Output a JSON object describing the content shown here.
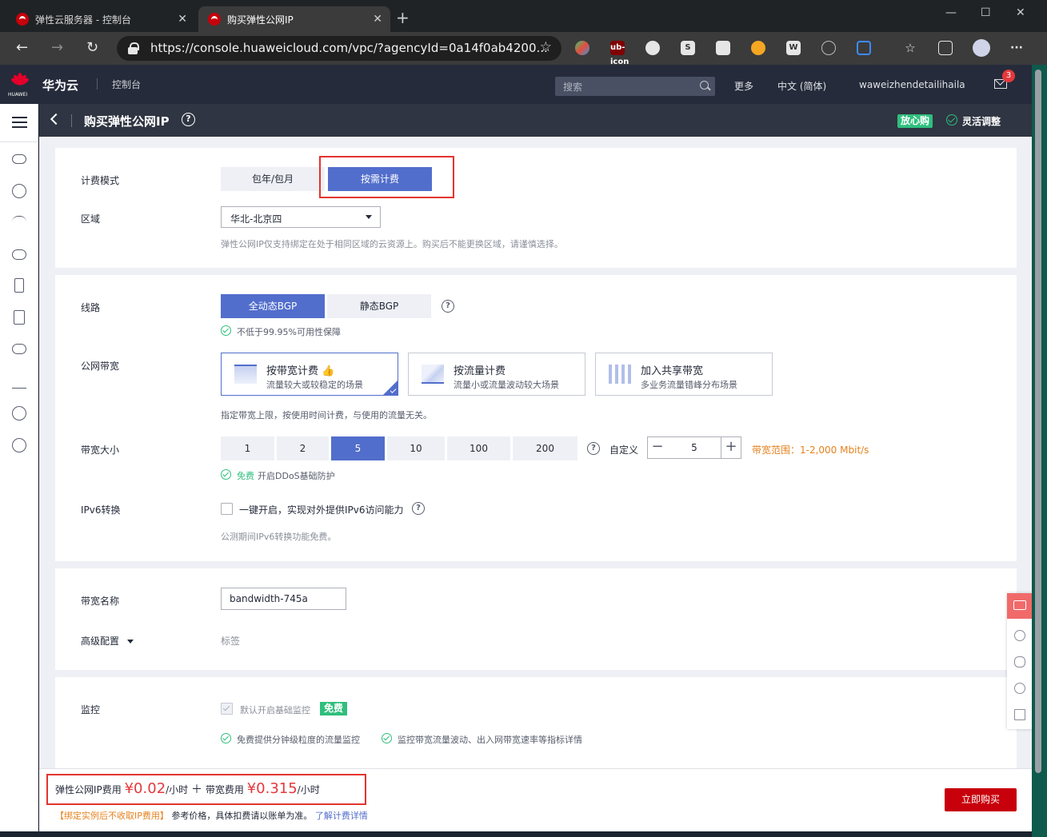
{
  "browser": {
    "tabs": [
      {
        "title": "弹性云服务器 - 控制台",
        "active": false
      },
      {
        "title": "购买弹性公网IP",
        "active": true
      }
    ],
    "url": "https://console.huaweicloud.com/vpc/?agencyId=0a14f0ab4200...",
    "extensions": [
      "ub-icon",
      "s-icon",
      "w-icon"
    ]
  },
  "header": {
    "logo_text": "HUAWEI",
    "brand": "华为云",
    "console": "控制台",
    "search_placeholder": "搜索",
    "more": "更多",
    "language": "中文 (简体)",
    "username": "waweizhendetailihaila",
    "mail_badge": "3"
  },
  "titlebar": {
    "title": "购买弹性公网IP",
    "help": "?",
    "fangxin": "放心购",
    "flex": "灵活调整"
  },
  "billing": {
    "label": "计费模式",
    "options": [
      "包年/包月",
      "按需计费"
    ],
    "selected": "按需计费"
  },
  "region": {
    "label": "区域",
    "value": "华北-北京四",
    "hint": "弹性公网IP仅支持绑定在处于相同区域的云资源上。购买后不能更换区域，请谨慎选择。"
  },
  "line": {
    "label": "线路",
    "options": [
      "全动态BGP",
      "静态BGP"
    ],
    "selected": "全动态BGP",
    "sla": "不低于99.95%可用性保障"
  },
  "bandwidth_type": {
    "label": "公网带宽",
    "options": [
      {
        "title": "按带宽计费",
        "desc": "流量较大或较稳定的场景",
        "selected": true
      },
      {
        "title": "按流量计费",
        "desc": "流量小或流量波动较大场景",
        "selected": false
      },
      {
        "title": "加入共享带宽",
        "desc": "多业务流量错峰分布场景",
        "selected": false
      }
    ],
    "hint": "指定带宽上限，按使用时间计费，与使用的流量无关。"
  },
  "bandwidth_size": {
    "label": "带宽大小",
    "options": [
      "1",
      "2",
      "5",
      "10",
      "100",
      "200"
    ],
    "selected": "5",
    "custom_label": "自定义",
    "custom_value": "5",
    "minus": "−",
    "plus": "+",
    "range": "带宽范围：1-2,000 Mbit/s",
    "ddos_free": "免费",
    "ddos_text": "开启DDoS基础防护"
  },
  "ipv6": {
    "label": "IPv6转换",
    "checkbox": "一键开启，实现对外提供IPv6访问能力",
    "hint": "公测期间IPv6转换功能免费。"
  },
  "name": {
    "label": "带宽名称",
    "value": "bandwidth-745a"
  },
  "advanced": {
    "label": "高级配置",
    "value": "标签"
  },
  "monitor": {
    "label": "监控",
    "checkbox": "默认开启基础监控",
    "free_badge": "免费",
    "features": [
      "免费提供分钟级粒度的流量监控",
      "监控带宽流量波动、出入网带宽速率等指标详情"
    ]
  },
  "footer": {
    "ip_fee_label": "弹性公网IP费用",
    "ip_fee": "¥0.02",
    "unit": "/小时",
    "plus": "＋",
    "bw_fee_label": "带宽费用",
    "bw_fee": "¥0.315",
    "note_red": "【绑定实例后不收取IP费用】",
    "note": "参考价格，具体扣费请以账单为准。",
    "link": "了解计费详情",
    "buy": "立即购买"
  },
  "colors": {
    "primary": "#526ecc",
    "brand_red": "#c7000b",
    "price_red": "#e4393c",
    "ok_green": "#2fbf7d",
    "range_orange": "#e6821e",
    "header_bg": "#252b3a"
  }
}
